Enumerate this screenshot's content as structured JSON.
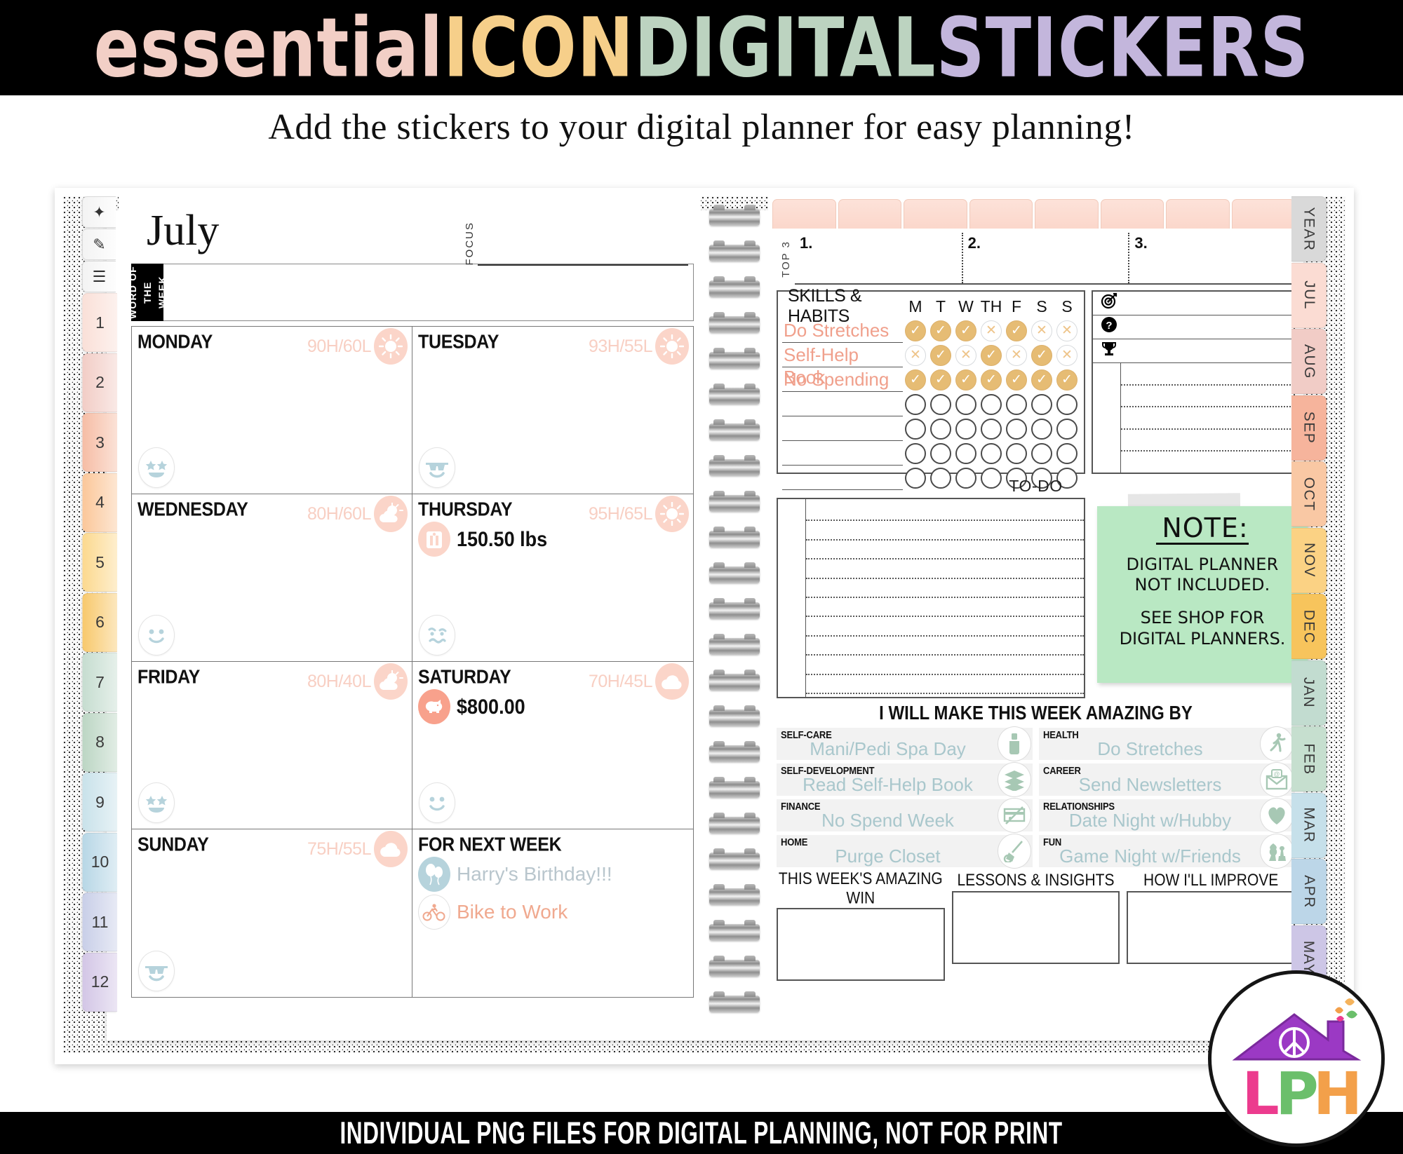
{
  "header": {
    "title_words": [
      {
        "text": "essential ",
        "color": "#f2cfc6"
      },
      {
        "text": "ICON ",
        "color": "#f6cf8a"
      },
      {
        "text": "DIGITAL ",
        "color": "#bcd3c0"
      },
      {
        "text": "STICKERS",
        "color": "#c3b6dc"
      }
    ],
    "title_plain": "essential ICON DIGITAL STICKERS",
    "subtitle": "Add the stickers to your digital planner for easy planning!"
  },
  "footer": {
    "banner": "INDIVIDUAL PNG FILES FOR DIGITAL PLANNING, NOT FOR PRINT"
  },
  "left_rail": {
    "icons": [
      "compass-icon",
      "clipboard-icon",
      "list-icon"
    ],
    "icon_glyphs": [
      "✦",
      "✎",
      "☰"
    ],
    "numbers": [
      "1",
      "2",
      "3",
      "4",
      "5",
      "6",
      "7",
      "8",
      "9",
      "10",
      "11",
      "12"
    ],
    "colors": [
      "#fae0d8",
      "#f2cdc6",
      "#f6bda5",
      "#fbc79a",
      "#fcd98f",
      "#f8c96d",
      "#c6ddd0",
      "#bcd6c4",
      "#c9e2ea",
      "#b8d7e6",
      "#c9cfe8",
      "#d3c6e6"
    ]
  },
  "right_rail": {
    "months": [
      "YEAR",
      "JUL",
      "AUG",
      "SEP",
      "OCT",
      "NOV",
      "DEC",
      "JAN",
      "FEB",
      "MAR",
      "APR",
      "MAY"
    ],
    "colors": [
      "#d9d9d9",
      "#fbdcd3",
      "#f1ccc6",
      "#f6b49c",
      "#f9c8a4",
      "#fbd284",
      "#f7c45c",
      "#c2dcd0",
      "#c6dfcf",
      "#c6e0ea",
      "#bcd6e8",
      "#cdc6e6"
    ]
  },
  "left_page": {
    "month": "July",
    "focus_label": "FOCUS",
    "word_of_week_label": "WORD OF\nTHE WEEK",
    "days": [
      {
        "name": "MONDAY",
        "temp": "90H/60L",
        "weather": "sun-icon",
        "emoji": "star-eyes-emoji",
        "items": []
      },
      {
        "name": "TUESDAY",
        "temp": "93H/55L",
        "weather": "sun-icon",
        "emoji": "sunglasses-emoji",
        "items": []
      },
      {
        "name": "WEDNESDAY",
        "temp": "80H/60L",
        "weather": "partly-cloudy-icon",
        "emoji": "smile-emoji",
        "items": []
      },
      {
        "name": "THURSDAY",
        "temp": "95H/65L",
        "weather": "sun-icon",
        "emoji": "confused-emoji",
        "items": [
          {
            "icon": "scale-icon",
            "icon_style": "peach",
            "value": "150.50 lbs",
            "value_style": "bold"
          }
        ]
      },
      {
        "name": "FRIDAY",
        "temp": "80H/40L",
        "weather": "partly-cloudy-icon",
        "emoji": "star-eyes-emoji",
        "items": []
      },
      {
        "name": "SATURDAY",
        "temp": "70H/45L",
        "weather": "cloud-icon",
        "emoji": "smile-emoji",
        "items": [
          {
            "icon": "piggy-bank-icon",
            "icon_style": "salmon",
            "value": "$800.00",
            "value_style": "bold"
          }
        ]
      },
      {
        "name": "SUNDAY",
        "temp": "75H/55L",
        "weather": "cloud-icon",
        "emoji": "sunglasses-emoji",
        "items": []
      },
      {
        "name": "FOR NEXT WEEK",
        "temp": "",
        "weather": "",
        "emoji": "",
        "items": [
          {
            "icon": "balloons-icon",
            "icon_style": "blue",
            "value": "Harry's Birthday!!!",
            "value_style": "blue"
          },
          {
            "icon": "bicycle-icon",
            "icon_style": "white",
            "value": "Bike to Work",
            "value_style": "peach"
          }
        ]
      }
    ]
  },
  "right_page": {
    "top_tabs_count": 8,
    "top3": {
      "label": "TOP 3",
      "items": [
        "1.",
        "2.",
        "3."
      ]
    },
    "habits": {
      "title": "SKILLS & HABITS",
      "day_cols": [
        "M",
        "T",
        "W",
        "TH",
        "F",
        "S",
        "S"
      ],
      "rows": [
        {
          "name": "Do Stretches",
          "marks": [
            "done",
            "done",
            "done",
            "miss",
            "done",
            "miss",
            "miss"
          ]
        },
        {
          "name": "Self-Help Book",
          "marks": [
            "miss",
            "done",
            "miss",
            "done",
            "miss",
            "done",
            "miss"
          ]
        },
        {
          "name": "No Spending",
          "marks": [
            "done",
            "done",
            "done",
            "done",
            "done",
            "done",
            "done"
          ]
        },
        {
          "name": "",
          "marks": [
            "empty",
            "empty",
            "empty",
            "empty",
            "empty",
            "empty",
            "empty"
          ]
        },
        {
          "name": "",
          "marks": [
            "empty",
            "empty",
            "empty",
            "empty",
            "empty",
            "empty",
            "empty"
          ]
        },
        {
          "name": "",
          "marks": [
            "empty",
            "empty",
            "empty",
            "empty",
            "empty",
            "empty",
            "empty"
          ]
        },
        {
          "name": "",
          "marks": [
            "empty",
            "empty",
            "empty",
            "empty",
            "empty",
            "empty",
            "empty"
          ]
        }
      ],
      "mark_done_color": "#e6bc74",
      "mark_check": "✓",
      "mark_cross": "✕"
    },
    "goal_icons": [
      "target-icon",
      "question-icon",
      "trophy-icon"
    ],
    "goal_glyphs": [
      "◎",
      "?",
      "Ἴ6"
    ],
    "todo_label": "TO-DO",
    "note": {
      "title": "NOTE:",
      "line1": "DIGITAL PLANNER NOT INCLUDED.",
      "line2": "SEE SHOP FOR DIGITAL PLANNERS.",
      "color": "#b9e8c3"
    },
    "amazing": {
      "title": "I WILL MAKE THIS WEEK AMAZING BY",
      "items": [
        {
          "category": "SELF-CARE",
          "value": "Mani/Pedi Spa Day",
          "icon": "nail-polish-icon"
        },
        {
          "category": "HEALTH",
          "value": "Do Stretches",
          "icon": "yoga-icon"
        },
        {
          "category": "SELF-DEVELOPMENT",
          "value": "Read Self-Help Book",
          "icon": "books-icon"
        },
        {
          "category": "CAREER",
          "value": "Send Newsletters",
          "icon": "email-icon"
        },
        {
          "category": "FINANCE",
          "value": "No Spend Week",
          "icon": "no-money-icon"
        },
        {
          "category": "RELATIONSHIPS",
          "value": "Date Night w/Hubby",
          "icon": "heart-icon"
        },
        {
          "category": "HOME",
          "value": "Purge Closet",
          "icon": "broom-icon"
        },
        {
          "category": "FUN",
          "value": "Game Night w/Friends",
          "icon": "chess-icon"
        }
      ]
    },
    "bottom_sections": [
      "THIS WEEK'S AMAZING WIN",
      "LESSONS & INSIGHTS",
      "HOW I'LL IMPROVE"
    ]
  },
  "logo": {
    "text": "LPH",
    "letter_colors": [
      "#ec3b8e",
      "#6bbf6b",
      "#f3a04a"
    ],
    "house_color": "#9b39c4"
  }
}
